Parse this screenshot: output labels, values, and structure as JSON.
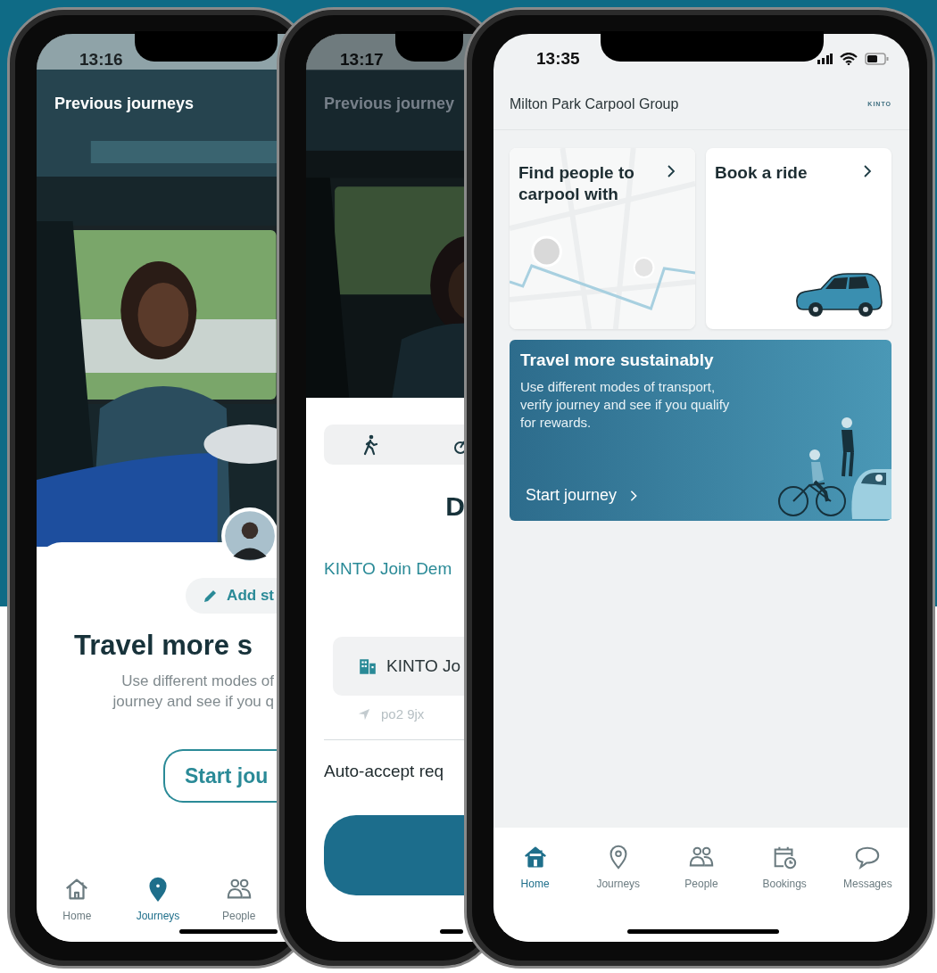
{
  "journeys_screen": {
    "status_time": "13:16",
    "title": "Previous journeys",
    "add_button": "Add st",
    "heading": "Travel more s",
    "description_lines": [
      "Use different modes of",
      "journey and see if you q"
    ],
    "start_button": "Start jou",
    "nav": [
      {
        "label": "Home",
        "selected": false
      },
      {
        "label": "Journeys",
        "selected": true
      },
      {
        "label": "People",
        "selected": false
      }
    ]
  },
  "join_screen": {
    "status_time": "13:17",
    "title": "Previous journey",
    "heading": "D",
    "organisation": "KINTO Join Dem",
    "location_field": "KINTO Jo",
    "postcode": "po2 9jx",
    "auto_accept": "Auto-accept req"
  },
  "home_screen": {
    "status_time": "13:35",
    "group_name": "Milton Park Carpool Group",
    "logo": "KINTO",
    "cards": [
      {
        "title": "Find people to carpool with"
      },
      {
        "title": "Book a ride"
      }
    ],
    "banner": {
      "title": "Travel more sustainably",
      "description": "Use different modes of transport, verify journey and see if you qualify for rewards.",
      "link": "Start journey"
    },
    "nav": [
      {
        "label": "Home",
        "selected": true
      },
      {
        "label": "Journeys",
        "selected": false
      },
      {
        "label": "People",
        "selected": false
      },
      {
        "label": "Bookings",
        "selected": false
      },
      {
        "label": "Messages",
        "selected": false
      }
    ]
  }
}
